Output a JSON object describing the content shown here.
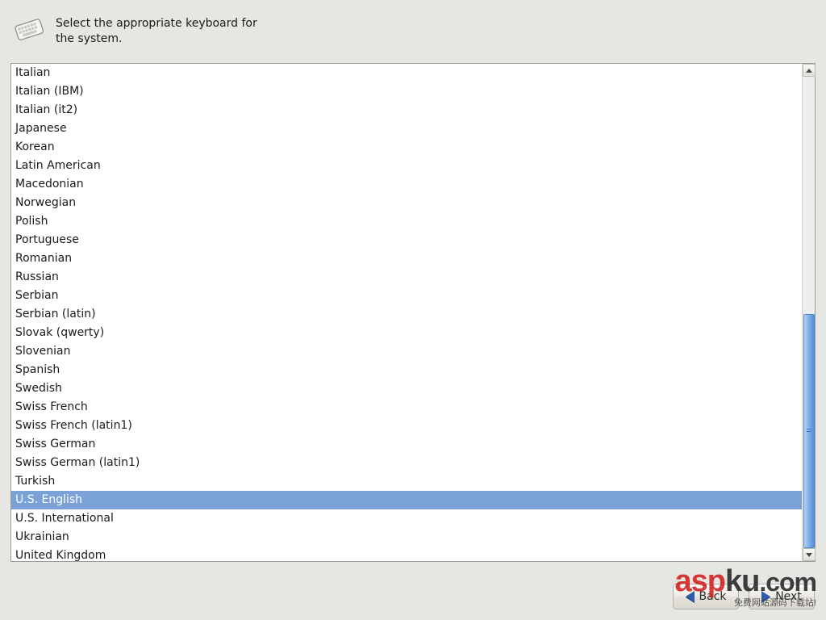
{
  "header": {
    "instruction": "Select the appropriate keyboard for the system."
  },
  "keyboard_list": {
    "selected_index": 23,
    "items": [
      "Italian",
      "Italian (IBM)",
      "Italian (it2)",
      "Japanese",
      "Korean",
      "Latin American",
      "Macedonian",
      "Norwegian",
      "Polish",
      "Portuguese",
      "Romanian",
      "Russian",
      "Serbian",
      "Serbian (latin)",
      "Slovak (qwerty)",
      "Slovenian",
      "Spanish",
      "Swedish",
      "Swiss French",
      "Swiss French (latin1)",
      "Swiss German",
      "Swiss German (latin1)",
      "Turkish",
      "U.S. English",
      "U.S. International",
      "Ukrainian",
      "United Kingdom"
    ]
  },
  "footer": {
    "back_label": "Back",
    "next_label": "Next"
  },
  "watermark": {
    "brand": "asp",
    "suffix": "ku",
    "tld": ".com",
    "tagline": "免费网站源码下载站!"
  }
}
